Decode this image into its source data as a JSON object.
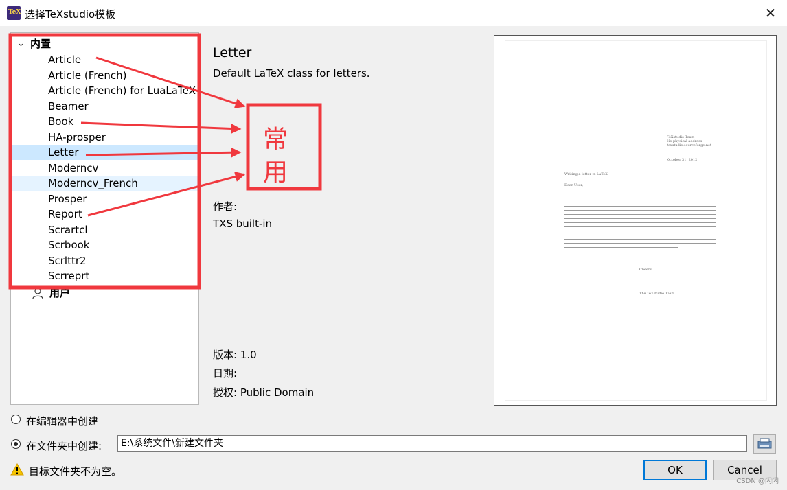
{
  "window": {
    "title": "选择TeXstudio模板",
    "close_glyph": "✕",
    "app_icon_text": "TeX"
  },
  "tree": {
    "builtin_label": "内置",
    "user_label": "用户",
    "selected_index": 6,
    "items": [
      "Article",
      "Article (French)",
      "Article (French) for LuaLaTeX",
      "Beamer",
      "Book",
      "HA-prosper",
      "Letter",
      "Moderncv",
      "Moderncv_French",
      "Prosper",
      "Report",
      "Scrartcl",
      "Scrbook",
      "Scrlttr2",
      "Scrreprt"
    ]
  },
  "info": {
    "title": "Letter",
    "description": "Default LaTeX class for letters.",
    "author_label": "作者:",
    "author_value": "TXS built-in",
    "version": "版本: 1.0",
    "date": "日期:",
    "license": "授权: Public Domain"
  },
  "preview": {
    "sender": [
      "TeXstudio Team",
      "No physical address",
      "texstudio.sourceforge.net"
    ],
    "date": "October 31, 2012",
    "subject": "Writing a letter in LaTeX",
    "opening": "Dear User,",
    "closing": "Cheers,",
    "signature": "The TeXstudio Team"
  },
  "options": {
    "in_editor_label": "在编辑器中创建",
    "in_folder_label": "在文件夹中创建:",
    "folder_path": "E:\\系统文件\\新建文件夹",
    "selected": "in_folder"
  },
  "warning": "目标文件夹不为空。",
  "buttons": {
    "ok": "OK",
    "cancel": "Cancel"
  },
  "annotation": {
    "chars": [
      "常",
      "用"
    ],
    "color": "#f0383e"
  },
  "watermark": "CSDN @闪闪"
}
